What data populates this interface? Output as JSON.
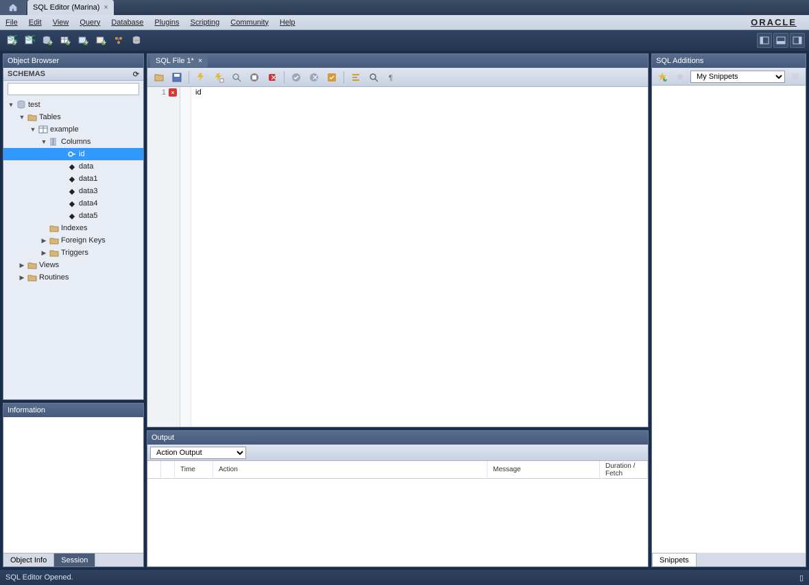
{
  "title_tab": "SQL Editor (Marina)",
  "menus": [
    "File",
    "Edit",
    "View",
    "Query",
    "Database",
    "Plugins",
    "Scripting",
    "Community",
    "Help"
  ],
  "oracle": "ORACLE",
  "object_browser": {
    "title": "Object Browser",
    "schemas_label": "SCHEMAS",
    "tree": {
      "db": "test",
      "tables_label": "Tables",
      "table": "example",
      "columns_label": "Columns",
      "columns": [
        "id",
        "data",
        "data1",
        "data3",
        "data4",
        "data5"
      ],
      "indexes": "Indexes",
      "fkeys": "Foreign Keys",
      "triggers": "Triggers",
      "views": "Views",
      "routines": "Routines"
    }
  },
  "information": {
    "title": "Information",
    "tabs": [
      "Object Info",
      "Session"
    ],
    "active": 1
  },
  "editor": {
    "tab": "SQL File 1*",
    "line_no": "1",
    "code": "id"
  },
  "output": {
    "title": "Output",
    "dropdown": "Action Output",
    "cols": [
      "",
      "",
      "Time",
      "Action",
      "Message",
      "Duration / Fetch"
    ]
  },
  "additions": {
    "title": "SQL Additions",
    "dropdown": "My Snippets",
    "tab": "Snippets"
  },
  "status": "SQL Editor Opened."
}
